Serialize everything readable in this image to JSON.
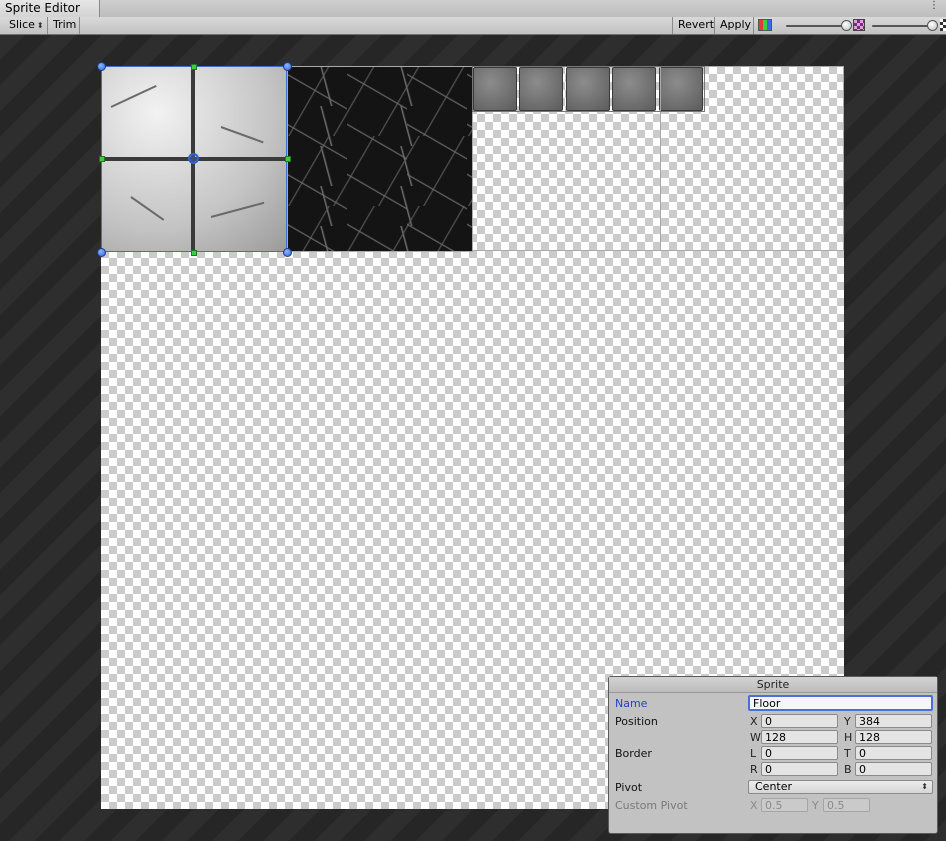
{
  "window": {
    "tab_title": "Sprite Editor"
  },
  "toolbar": {
    "slice_label": "Slice",
    "trim_label": "Trim",
    "revert_label": "Revert",
    "apply_label": "Apply",
    "zoom_level": 0.95,
    "mip_level": 0.95
  },
  "inspector": {
    "title": "Sprite",
    "name_label": "Name",
    "name_value": "Floor",
    "position_label": "Position",
    "x_axis": "X",
    "x_value": "0",
    "y_axis": "Y",
    "y_value": "384",
    "w_axis": "W",
    "w_value": "128",
    "h_axis": "H",
    "h_value": "128",
    "border_label": "Border",
    "l_axis": "L",
    "l_value": "0",
    "t_axis": "T",
    "t_value": "0",
    "r_axis": "R",
    "r_value": "0",
    "b_axis": "B",
    "b_value": "0",
    "pivot_label": "Pivot",
    "pivot_value": "Center",
    "custom_pivot_label": "Custom Pivot",
    "cp_x_axis": "X",
    "cp_x_value": "0.5",
    "cp_y_axis": "Y",
    "cp_y_value": "0.5"
  },
  "colors": {
    "selection": "#3f6ed1",
    "edge_handle": "#3ccf3c",
    "active_label": "#1f46c4"
  }
}
